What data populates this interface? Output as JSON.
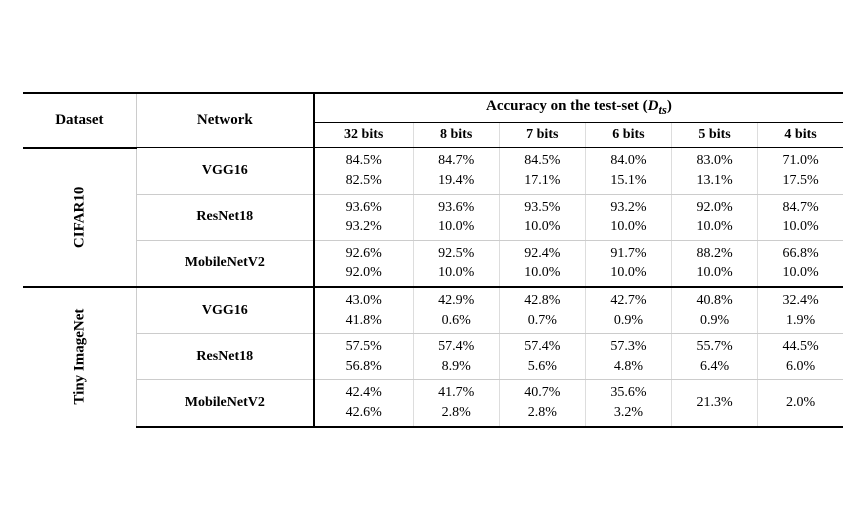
{
  "table": {
    "headers": {
      "dataset": "Dataset",
      "network": "Network",
      "accuracy_span": "Accuracy on the test-set",
      "accuracy_sub": "(D_ts)",
      "bits": [
        "32 bits",
        "8 bits",
        "7 bits",
        "6 bits",
        "5 bits",
        "4 bits"
      ]
    },
    "sections": [
      {
        "dataset": "CIFAR10",
        "rows": [
          {
            "network": "VGG16",
            "values": [
              {
                "line1": "84.5%",
                "line2": "82.5%"
              },
              {
                "line1": "84.7%",
                "line2": "19.4%"
              },
              {
                "line1": "84.5%",
                "line2": "17.1%"
              },
              {
                "line1": "84.0%",
                "line2": "15.1%"
              },
              {
                "line1": "83.0%",
                "line2": "13.1%"
              },
              {
                "line1": "71.0%",
                "line2": "17.5%"
              }
            ]
          },
          {
            "network": "ResNet18",
            "values": [
              {
                "line1": "93.6%",
                "line2": "93.2%"
              },
              {
                "line1": "93.6%",
                "line2": "10.0%"
              },
              {
                "line1": "93.5%",
                "line2": "10.0%"
              },
              {
                "line1": "93.2%",
                "line2": "10.0%"
              },
              {
                "line1": "92.0%",
                "line2": "10.0%"
              },
              {
                "line1": "84.7%",
                "line2": "10.0%"
              }
            ]
          },
          {
            "network": "MobileNetV2",
            "values": [
              {
                "line1": "92.6%",
                "line2": "92.0%"
              },
              {
                "line1": "92.5%",
                "line2": "10.0%"
              },
              {
                "line1": "92.4%",
                "line2": "10.0%"
              },
              {
                "line1": "91.7%",
                "line2": "10.0%"
              },
              {
                "line1": "88.2%",
                "line2": "10.0%"
              },
              {
                "line1": "66.8%",
                "line2": "10.0%"
              }
            ]
          }
        ]
      },
      {
        "dataset": "Tiny ImageNet",
        "rows": [
          {
            "network": "VGG16",
            "values": [
              {
                "line1": "43.0%",
                "line2": "41.8%"
              },
              {
                "line1": "42.9%",
                "line2": "0.6%"
              },
              {
                "line1": "42.8%",
                "line2": "0.7%"
              },
              {
                "line1": "42.7%",
                "line2": "0.9%"
              },
              {
                "line1": "40.8%",
                "line2": "0.9%"
              },
              {
                "line1": "32.4%",
                "line2": "1.9%"
              }
            ]
          },
          {
            "network": "ResNet18",
            "values": [
              {
                "line1": "57.5%",
                "line2": "56.8%"
              },
              {
                "line1": "57.4%",
                "line2": "8.9%"
              },
              {
                "line1": "57.4%",
                "line2": "5.6%"
              },
              {
                "line1": "57.3%",
                "line2": "4.8%"
              },
              {
                "line1": "55.7%",
                "line2": "6.4%"
              },
              {
                "line1": "44.5%",
                "line2": "6.0%"
              }
            ]
          },
          {
            "network": "MobileNetV2",
            "values": [
              {
                "line1": "42.4%",
                "line2": "42.6%"
              },
              {
                "line1": "41.7%",
                "line2": "2.8%"
              },
              {
                "line1": "40.7%",
                "line2": "2.8%"
              },
              {
                "line1": "35.6%",
                "line2": "3.2%"
              },
              {
                "line1": "21.3%",
                "line2": ""
              },
              {
                "line1": "2.0%",
                "line2": ""
              }
            ]
          }
        ]
      }
    ]
  }
}
